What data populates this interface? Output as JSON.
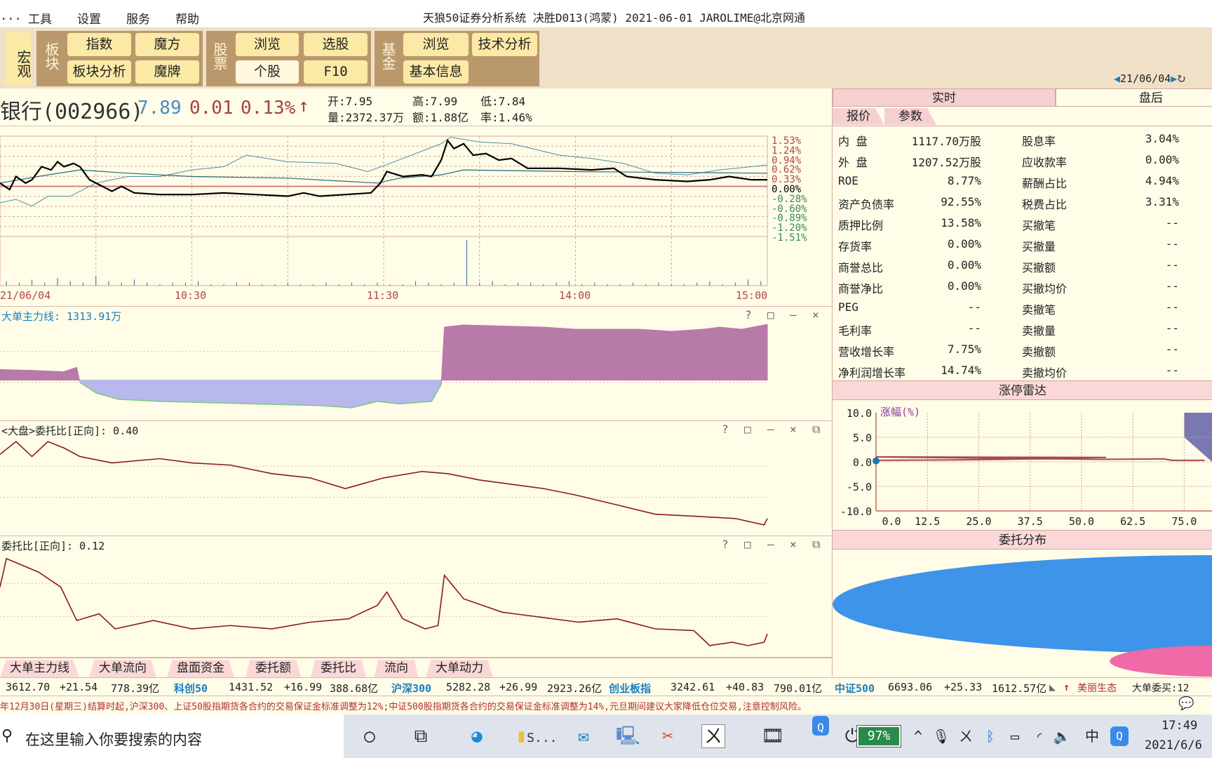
{
  "menu": {
    "items": [
      "...",
      "工具",
      "设置",
      "服务",
      "帮助"
    ],
    "title": "天狼50证券分析系统  决胜D013(鸿蒙)  2021-06-01 JAROLIME@北京网通"
  },
  "toolbar": {
    "macro": "宏观",
    "sector": {
      "label": "板块",
      "buttons": [
        "指数",
        "魔方",
        "板块分析",
        "魔牌"
      ]
    },
    "stock": {
      "label": "股票",
      "buttons": [
        "浏览",
        "选股",
        "个股",
        "F10"
      ]
    },
    "fund": {
      "label": "基金",
      "buttons": [
        "浏览",
        "技术分析",
        "基本信息"
      ]
    },
    "date": "21/06/04"
  },
  "stock": {
    "name": "银行(002966)",
    "price": "7.89",
    "change": "0.01",
    "pct": "0.13%",
    "arrow": "↑",
    "open": "开:7.95",
    "high": "高:7.99",
    "low": "低:7.84",
    "vol": "量:2372.37万",
    "amount": "额:1.88亿",
    "turnover": "率:1.46%"
  },
  "price_chart": {
    "y_labels_pos": [
      "1.53%",
      "1.24%",
      "0.94%",
      "0.62%",
      "0.33%"
    ],
    "y_zero": "0.00%",
    "y_labels_neg": [
      "-0.28%",
      "-0.60%",
      "-0.89%",
      "-1.20%",
      "-1.51%"
    ],
    "ylim": [
      -1.53,
      1.53
    ],
    "x_labels": [
      "21/06/04",
      "10:30",
      "11:30",
      "14:00",
      "15:00"
    ],
    "price_pct": [
      [
        0,
        0.1
      ],
      [
        3,
        -0.1
      ],
      [
        5,
        0.3
      ],
      [
        8,
        0.1
      ],
      [
        10,
        0.2
      ],
      [
        13,
        0.6
      ],
      [
        16,
        0.5
      ],
      [
        18,
        0.75
      ],
      [
        20,
        0.6
      ],
      [
        23,
        0.7
      ],
      [
        25,
        0.6
      ],
      [
        28,
        0.2
      ],
      [
        31,
        0.05
      ],
      [
        35,
        -0.15
      ],
      [
        38,
        0.0
      ],
      [
        42,
        -0.2
      ],
      [
        50,
        -0.25
      ],
      [
        60,
        -0.25
      ],
      [
        70,
        -0.2
      ],
      [
        80,
        -0.25
      ],
      [
        90,
        -0.3
      ],
      [
        95,
        -0.2
      ],
      [
        100,
        -0.3
      ],
      [
        108,
        -0.25
      ],
      [
        116,
        -0.2
      ],
      [
        119,
        0.1
      ],
      [
        121,
        0.45
      ],
      [
        126,
        0.3
      ],
      [
        132,
        0.35
      ],
      [
        135,
        0.3
      ],
      [
        138,
        0.8
      ],
      [
        140,
        1.4
      ],
      [
        142,
        1.15
      ],
      [
        145,
        1.3
      ],
      [
        148,
        0.95
      ],
      [
        152,
        1.0
      ],
      [
        156,
        0.8
      ],
      [
        160,
        0.85
      ],
      [
        165,
        0.55
      ],
      [
        175,
        0.55
      ],
      [
        185,
        0.5
      ],
      [
        192,
        0.55
      ],
      [
        196,
        0.3
      ],
      [
        205,
        0.2
      ],
      [
        215,
        0.15
      ],
      [
        222,
        0.2
      ],
      [
        228,
        0.3
      ],
      [
        235,
        0.2
      ],
      [
        240,
        0.2
      ]
    ],
    "avg_pct": [
      [
        0,
        0.1
      ],
      [
        15,
        0.35
      ],
      [
        25,
        0.5
      ],
      [
        40,
        0.4
      ],
      [
        60,
        0.3
      ],
      [
        90,
        0.25
      ],
      [
        118,
        0.1
      ],
      [
        125,
        0.25
      ],
      [
        138,
        0.35
      ],
      [
        145,
        0.5
      ],
      [
        180,
        0.45
      ],
      [
        240,
        0.4
      ]
    ],
    "index_pct": [
      [
        0,
        -0.5
      ],
      [
        5,
        -0.4
      ],
      [
        10,
        -0.6
      ],
      [
        15,
        -0.3
      ],
      [
        22,
        -0.3
      ],
      [
        30,
        0.1
      ],
      [
        40,
        0.3
      ],
      [
        50,
        0.3
      ],
      [
        60,
        0.5
      ],
      [
        70,
        0.6
      ],
      [
        77,
        0.95
      ],
      [
        90,
        0.75
      ],
      [
        105,
        0.7
      ],
      [
        115,
        0.45
      ],
      [
        122,
        0.7
      ],
      [
        130,
        1.0
      ],
      [
        138,
        1.3
      ],
      [
        141,
        1.5
      ],
      [
        150,
        1.35
      ],
      [
        160,
        1.3
      ],
      [
        175,
        0.95
      ],
      [
        185,
        0.85
      ],
      [
        195,
        0.7
      ],
      [
        205,
        0.4
      ],
      [
        215,
        0.35
      ],
      [
        225,
        0.5
      ],
      [
        240,
        0.65
      ]
    ],
    "volume": [
      3,
      2,
      4,
      2,
      5,
      3,
      2,
      6,
      3,
      2,
      4,
      2,
      1,
      2,
      2,
      3,
      1,
      1,
      2,
      2,
      1,
      1,
      2,
      1,
      1,
      2,
      1,
      2,
      1,
      2,
      1,
      1,
      3,
      2,
      1,
      2,
      30,
      2,
      3,
      1,
      2,
      2,
      1,
      2,
      3,
      1,
      2,
      1,
      1,
      2,
      1,
      2,
      1,
      1,
      2,
      3,
      1,
      2,
      4,
      3
    ]
  },
  "panels": [
    {
      "title": "大单主力线: 1313.91万",
      "series": [
        [
          0,
          250
        ],
        [
          10,
          230
        ],
        [
          20,
          200
        ],
        [
          24,
          300
        ],
        [
          25,
          -50
        ],
        [
          30,
          -300
        ],
        [
          37,
          -450
        ],
        [
          50,
          -500
        ],
        [
          75,
          -550
        ],
        [
          100,
          -600
        ],
        [
          110,
          -650
        ],
        [
          118,
          -500
        ],
        [
          125,
          -560
        ],
        [
          135,
          -500
        ],
        [
          138,
          -100
        ],
        [
          139,
          1250
        ],
        [
          145,
          1300
        ],
        [
          170,
          1250
        ],
        [
          180,
          1200
        ],
        [
          200,
          1200
        ],
        [
          210,
          1150
        ],
        [
          220,
          1200
        ],
        [
          225,
          1250
        ],
        [
          232,
          1200
        ],
        [
          240,
          1313.91
        ]
      ],
      "ylim": [
        -800,
        1400
      ]
    },
    {
      "title": "<大盘>委托比[正向]:  0.40",
      "series": [
        [
          0,
          0.73
        ],
        [
          5,
          0.79
        ],
        [
          10,
          0.72
        ],
        [
          15,
          0.79
        ],
        [
          20,
          0.76
        ],
        [
          25,
          0.72
        ],
        [
          35,
          0.69
        ],
        [
          50,
          0.71
        ],
        [
          60,
          0.69
        ],
        [
          72,
          0.68
        ],
        [
          85,
          0.64
        ],
        [
          97,
          0.62
        ],
        [
          108,
          0.57
        ],
        [
          120,
          0.62
        ],
        [
          132,
          0.65
        ],
        [
          140,
          0.64
        ],
        [
          150,
          0.61
        ],
        [
          170,
          0.57
        ],
        [
          180,
          0.54
        ],
        [
          194,
          0.49
        ],
        [
          205,
          0.45
        ],
        [
          218,
          0.44
        ],
        [
          230,
          0.43
        ],
        [
          239,
          0.4
        ],
        [
          240,
          0.43
        ]
      ],
      "ylim": [
        0.38,
        0.82
      ]
    },
    {
      "title": "委托比[正向]:  0.12",
      "series": [
        [
          0,
          0.43
        ],
        [
          2,
          0.6
        ],
        [
          7,
          0.56
        ],
        [
          12,
          0.52
        ],
        [
          19,
          0.43
        ],
        [
          24,
          0.23
        ],
        [
          31,
          0.27
        ],
        [
          36,
          0.18
        ],
        [
          48,
          0.23
        ],
        [
          60,
          0.18
        ],
        [
          72,
          0.2
        ],
        [
          85,
          0.18
        ],
        [
          97,
          0.22
        ],
        [
          109,
          0.24
        ],
        [
          118,
          0.32
        ],
        [
          121,
          0.4
        ],
        [
          126,
          0.24
        ],
        [
          133,
          0.18
        ],
        [
          137,
          0.2
        ],
        [
          139,
          0.5
        ],
        [
          145,
          0.36
        ],
        [
          157,
          0.28
        ],
        [
          169,
          0.25
        ],
        [
          181,
          0.22
        ],
        [
          193,
          0.24
        ],
        [
          205,
          0.18
        ],
        [
          217,
          0.17
        ],
        [
          222,
          0.08
        ],
        [
          229,
          0.1
        ],
        [
          234,
          0.08
        ],
        [
          239,
          0.1
        ],
        [
          240,
          0.15
        ]
      ],
      "ylim": [
        0.05,
        0.65
      ]
    }
  ],
  "panel_controls": [
    "?",
    "□",
    "—",
    "×",
    "⧉"
  ],
  "bottom_tabs": [
    "大单主力线",
    "大单流向",
    "盘面资金",
    "委托额",
    "委托比",
    "流向",
    "大单动力"
  ],
  "index_bar": [
    {
      "name": "",
      "value": "3612.70",
      "change": "+21.54",
      "amount": "778.39亿"
    },
    {
      "name": "科创50",
      "value": "1431.52",
      "change": "+16.99",
      "amount": "388.68亿"
    },
    {
      "name": "沪深300",
      "value": "5282.28",
      "change": "+26.99",
      "amount": "2923.26亿"
    },
    {
      "name": "创业板指",
      "value": "3242.61",
      "change": "+40.83",
      "amount": "790.01亿"
    },
    {
      "name": "中证500",
      "value": "6693.06",
      "change": "+25.33",
      "amount": "1612.57亿"
    }
  ],
  "index_extra": {
    "arrow": "↑",
    "sector": "美丽生态",
    "big_buy": "大单委买:12"
  },
  "ticker": "年12月30日(星期三)结算时起,沪深300、上证50股指期货各合约的交易保证金标准调整为12%;中证500股指期货各合约的交易保证金标准调整为14%,元旦期间建议大家降低仓位交易,注意控制风险。",
  "right": {
    "tabs": [
      "实时",
      "盘后"
    ],
    "subtabs": [
      "报价",
      "参数"
    ],
    "rows": [
      [
        "内  盘",
        "1117.70万股",
        "股息率",
        "3.04%"
      ],
      [
        "外  盘",
        "1207.52万股",
        "应收款率",
        "0.00%"
      ],
      [
        "ROE",
        "8.77%",
        "薪酬占比",
        "4.94%"
      ],
      [
        "资产负债率",
        "92.55%",
        "税费占比",
        "3.31%"
      ],
      [
        "质押比例",
        "13.58%",
        "买撤笔",
        "--"
      ],
      [
        "存货率",
        "0.00%",
        "买撤量",
        "--"
      ],
      [
        "商誉总比",
        "0.00%",
        "买撤额",
        "--"
      ],
      [
        "商誉净比",
        "0.00%",
        "买撤均价",
        "--"
      ],
      [
        "PEG",
        "--",
        "卖撤笔",
        "--"
      ],
      [
        "毛利率",
        "--",
        "卖撤量",
        "--"
      ],
      [
        "营收增长率",
        "7.75%",
        "卖撤额",
        "--"
      ],
      [
        "净利润增长率",
        "14.74%",
        "卖撤均价",
        "--"
      ]
    ],
    "radar": {
      "title": "涨停雷达",
      "ylabel": "涨幅(%)",
      "y_ticks": [
        "10.0",
        "5.0",
        "0.0",
        "-5.0",
        "-10.0"
      ],
      "x_ticks": [
        "0.0",
        "12.5",
        "25.0",
        "37.5",
        "50.0",
        "62.5",
        "75.0"
      ],
      "xlim": [
        0,
        85
      ],
      "ylim": [
        -10,
        10
      ]
    },
    "distribution": {
      "title": "委托分布"
    }
  },
  "taskbar": {
    "search_placeholder": "在这里输入你要搜索的内容",
    "app_label": "S...",
    "battery": "97%",
    "time": "17:49",
    "date": "2021/6/6",
    "ime": "中"
  },
  "colors": {
    "price": "#000000",
    "avg": "#2a6a7a",
    "index": "#4a90a8",
    "panel_line": "#8b1a1a",
    "pos_area": "#b87aa8",
    "neg_area": "#b8b8ec",
    "up": "#b04848",
    "down": "#3a8a5a",
    "blue": "#1a7fc0"
  }
}
